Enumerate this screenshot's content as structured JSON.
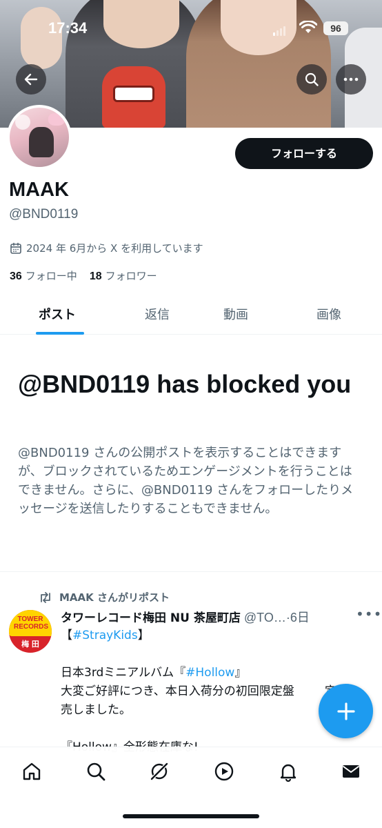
{
  "status_bar": {
    "time": "17:34",
    "battery": "96"
  },
  "profile": {
    "display_name": "MAAK",
    "handle": "@BND0119",
    "joined": "2024 年 6月から X を利用しています",
    "following_count": "36",
    "following_label": "フォロー中",
    "followers_count": "18",
    "followers_label": "フォロワー",
    "follow_button": "フォローする"
  },
  "tabs": [
    {
      "label": "ポスト",
      "active": true
    },
    {
      "label": "返信",
      "active": false
    },
    {
      "label": "動画",
      "active": false
    },
    {
      "label": "画像",
      "active": false
    }
  ],
  "blocked": {
    "title": "@BND0119 has blocked you",
    "description": "@BND0119 さんの公開ポストを表示することはできますが、ブロックされているためエンゲージメントを行うことはできません。さらに、@BND0119 さんをフォローしたりメッセージを送信したりすることもできません。"
  },
  "tweet": {
    "repost_label": "MAAK さんがリポスト",
    "display_name": "タワーレコード梅田 NU 茶屋町店",
    "meta": " @TO…·6日",
    "avatar_line1": "TOWER RECORDS",
    "avatar_line2": "梅 田",
    "hashtag1": "#StrayKids",
    "line2_prefix": "日本3rdミニアルバム『",
    "hashtag2": "#Hollow",
    "line2_suffix": "』",
    "line3": "大変ご好評につき、本日入荷分の初回限定盤",
    "line3_tail": "定",
    "line4": "売しました。",
    "line5_partial": "『Hollow』全形態在庫な!"
  },
  "nav": [
    "home-icon",
    "search-icon",
    "grok-icon",
    "video-icon",
    "notifications-icon",
    "messages-icon"
  ],
  "colors": {
    "accent": "#1d9bf0",
    "text": "#0f1419",
    "secondary": "#536471"
  }
}
